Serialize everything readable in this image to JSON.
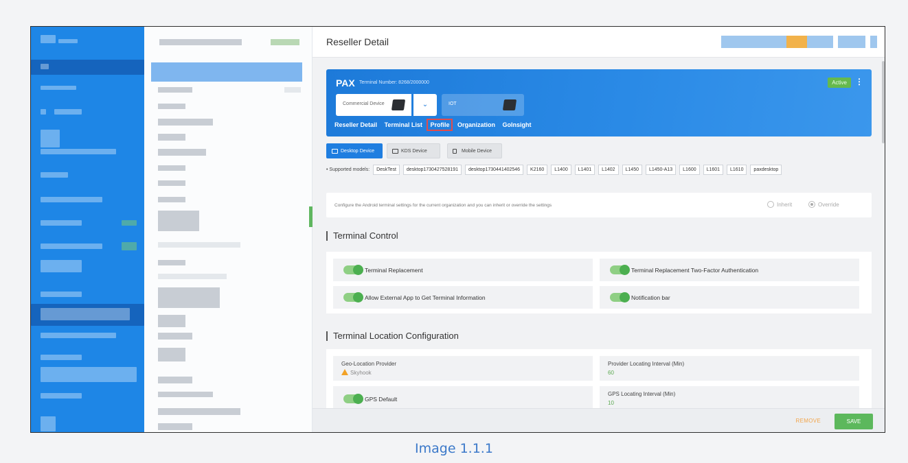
{
  "page": {
    "title": "Reseller Detail"
  },
  "header": {
    "brand": "PAX",
    "terminal_number": "Terminal Number: 8268/2000000",
    "status": "Active",
    "device_type": "Commercial Device",
    "device_type_2": "IOT",
    "tabs": [
      "Reseller Detail",
      "Terminal List",
      "Profile",
      "Organization",
      "GoInsight"
    ],
    "selected_tab": "Profile"
  },
  "device_tabs": [
    "Desktop Device",
    "KDS Device",
    "Mobile Device"
  ],
  "models": {
    "label": "• Supported models:",
    "items": [
      "DeskTest",
      "desktop1730427528191",
      "desktop1730441402546",
      "K2160",
      "L1400",
      "L1401",
      "L1402",
      "L1450",
      "L1450-A13",
      "L1600",
      "L1601",
      "L1610",
      "paxdesktop"
    ]
  },
  "config": {
    "note": "Configure the Android terminal settings for the current organization and you can inherit or override the settings",
    "inherit": "Inherit",
    "override": "Override",
    "selected": "Override"
  },
  "terminal_control": {
    "title": "Terminal Control",
    "items": [
      {
        "label": "Terminal Replacement",
        "on": true
      },
      {
        "label": "Terminal Replacement Two-Factor Authentication",
        "on": true
      },
      {
        "label": "Allow External App to Get Terminal Information",
        "on": true
      },
      {
        "label": "Notification bar",
        "on": true
      }
    ]
  },
  "location": {
    "title": "Terminal Location Configuration",
    "geo_label": "Geo-Location Provider",
    "geo_value": "Skyhook",
    "provider_interval_label": "Provider Locating Interval (Min)",
    "provider_interval_value": "60",
    "gps_default_label": "GPS Default",
    "gps_interval_label": "GPS Locating Interval (Min)",
    "gps_interval_value": "10"
  },
  "footer": {
    "remove": "REMOVE",
    "save": "SAVE"
  },
  "caption": "Image 1.1.1",
  "colors": {
    "primary": "#1f7ee0",
    "success": "#5cb85c",
    "warning": "#f2a227",
    "highlight": "#e24c4c"
  }
}
